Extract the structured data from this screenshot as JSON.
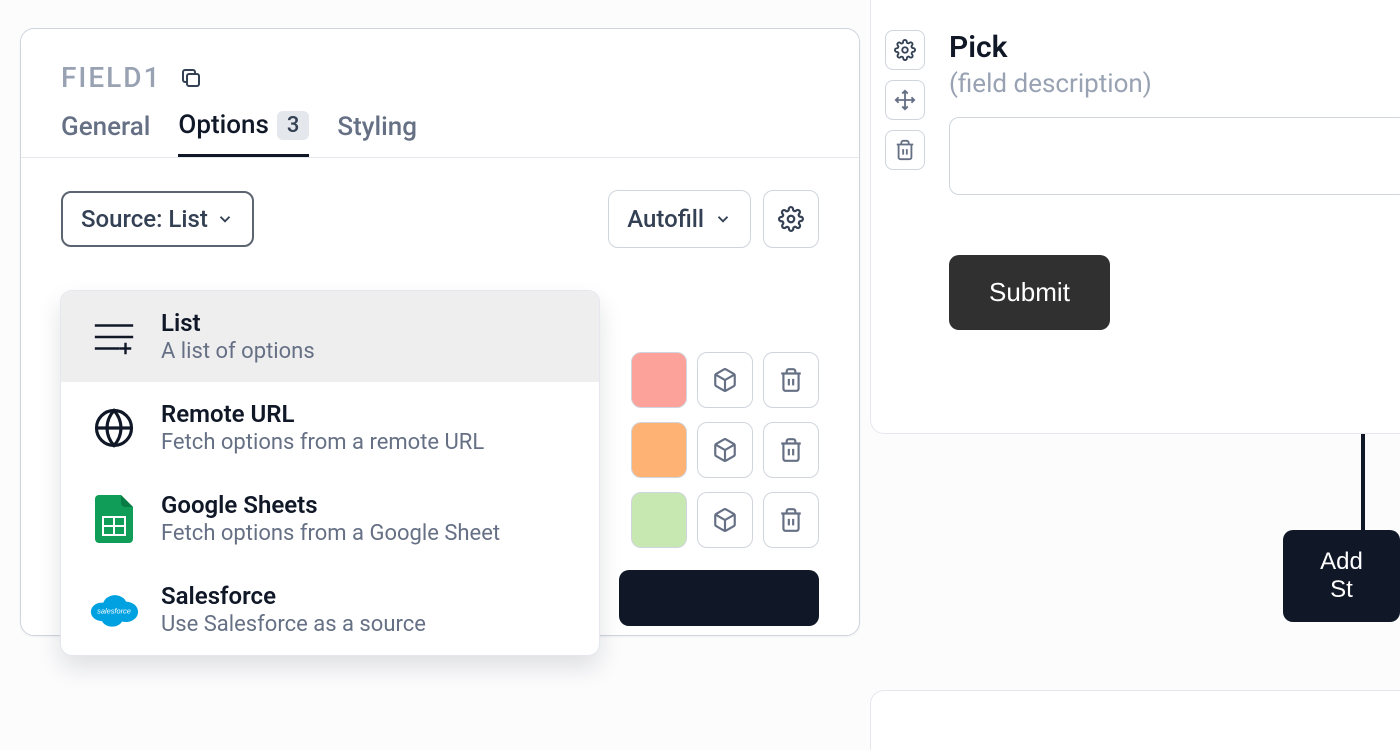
{
  "field": {
    "name": "FIELD1"
  },
  "tabs": {
    "general": "General",
    "options": "Options",
    "options_count": "3",
    "styling": "Styling"
  },
  "toolbar": {
    "source_label": "Source: List",
    "autofill_label": "Autofill"
  },
  "source_menu": {
    "list": {
      "title": "List",
      "desc": "A list of options"
    },
    "remote": {
      "title": "Remote URL",
      "desc": "Fetch options from a remote URL"
    },
    "sheets": {
      "title": "Google Sheets",
      "desc": "Fetch options from a Google Sheet"
    },
    "salesforce": {
      "title": "Salesforce",
      "desc": "Use Salesforce as a source"
    }
  },
  "option_colors": [
    "#fda29b",
    "#feb273",
    "#c7e8b0"
  ],
  "preview": {
    "title": "Pick",
    "desc": "(field description)",
    "submit": "Submit"
  },
  "add_step": "Add St"
}
